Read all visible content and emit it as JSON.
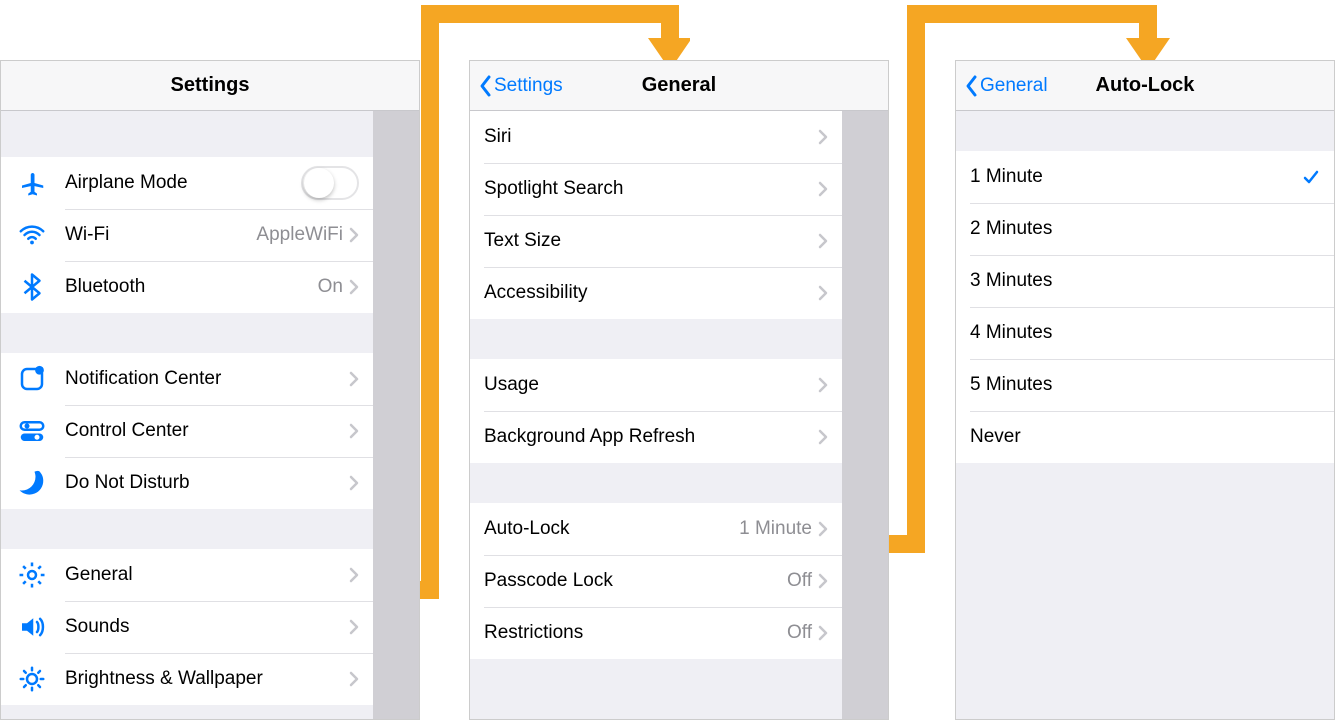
{
  "panel_settings": {
    "title": "Settings",
    "groups": [
      {
        "rows": [
          {
            "id": "airplane-mode",
            "icon": "airplane-icon",
            "label": "Airplane Mode",
            "control": "toggle"
          },
          {
            "id": "wifi",
            "icon": "wifi-icon",
            "label": "Wi-Fi",
            "value": "AppleWiFi",
            "control": "disclosure"
          },
          {
            "id": "bluetooth",
            "icon": "bluetooth-icon",
            "label": "Bluetooth",
            "value": "On",
            "control": "disclosure"
          }
        ]
      },
      {
        "rows": [
          {
            "id": "notification-center",
            "icon": "notification-center-icon",
            "label": "Notification Center",
            "control": "disclosure"
          },
          {
            "id": "control-center",
            "icon": "control-center-icon",
            "label": "Control Center",
            "control": "disclosure"
          },
          {
            "id": "do-not-disturb",
            "icon": "do-not-disturb-icon",
            "label": "Do Not Disturb",
            "control": "disclosure"
          }
        ]
      },
      {
        "rows": [
          {
            "id": "general",
            "icon": "gear-icon",
            "label": "General",
            "control": "disclosure"
          },
          {
            "id": "sounds",
            "icon": "sounds-icon",
            "label": "Sounds",
            "control": "disclosure"
          },
          {
            "id": "brightness-wallpaper",
            "icon": "brightness-icon",
            "label": "Brightness & Wallpaper",
            "control": "disclosure"
          }
        ]
      }
    ]
  },
  "panel_general": {
    "back_label": "Settings",
    "title": "General",
    "groups": [
      {
        "rows": [
          {
            "id": "siri",
            "label": "Siri",
            "control": "disclosure"
          },
          {
            "id": "spotlight-search",
            "label": "Spotlight Search",
            "control": "disclosure"
          },
          {
            "id": "text-size",
            "label": "Text Size",
            "control": "disclosure"
          },
          {
            "id": "accessibility",
            "label": "Accessibility",
            "control": "disclosure"
          }
        ]
      },
      {
        "rows": [
          {
            "id": "usage",
            "label": "Usage",
            "control": "disclosure"
          },
          {
            "id": "background-app-refresh",
            "label": "Background App Refresh",
            "control": "disclosure"
          }
        ]
      },
      {
        "rows": [
          {
            "id": "auto-lock",
            "label": "Auto-Lock",
            "value": "1 Minute",
            "control": "disclosure"
          },
          {
            "id": "passcode-lock",
            "label": "Passcode Lock",
            "value": "Off",
            "control": "disclosure"
          },
          {
            "id": "restrictions",
            "label": "Restrictions",
            "value": "Off",
            "control": "disclosure"
          }
        ]
      }
    ]
  },
  "panel_autolock": {
    "back_label": "General",
    "title": "Auto-Lock",
    "options": [
      {
        "id": "1-minute",
        "label": "1 Minute",
        "selected": true
      },
      {
        "id": "2-minutes",
        "label": "2 Minutes",
        "selected": false
      },
      {
        "id": "3-minutes",
        "label": "3 Minutes",
        "selected": false
      },
      {
        "id": "4-minutes",
        "label": "4 Minutes",
        "selected": false
      },
      {
        "id": "5-minutes",
        "label": "5 Minutes",
        "selected": false
      },
      {
        "id": "never",
        "label": "Never",
        "selected": false
      }
    ]
  }
}
